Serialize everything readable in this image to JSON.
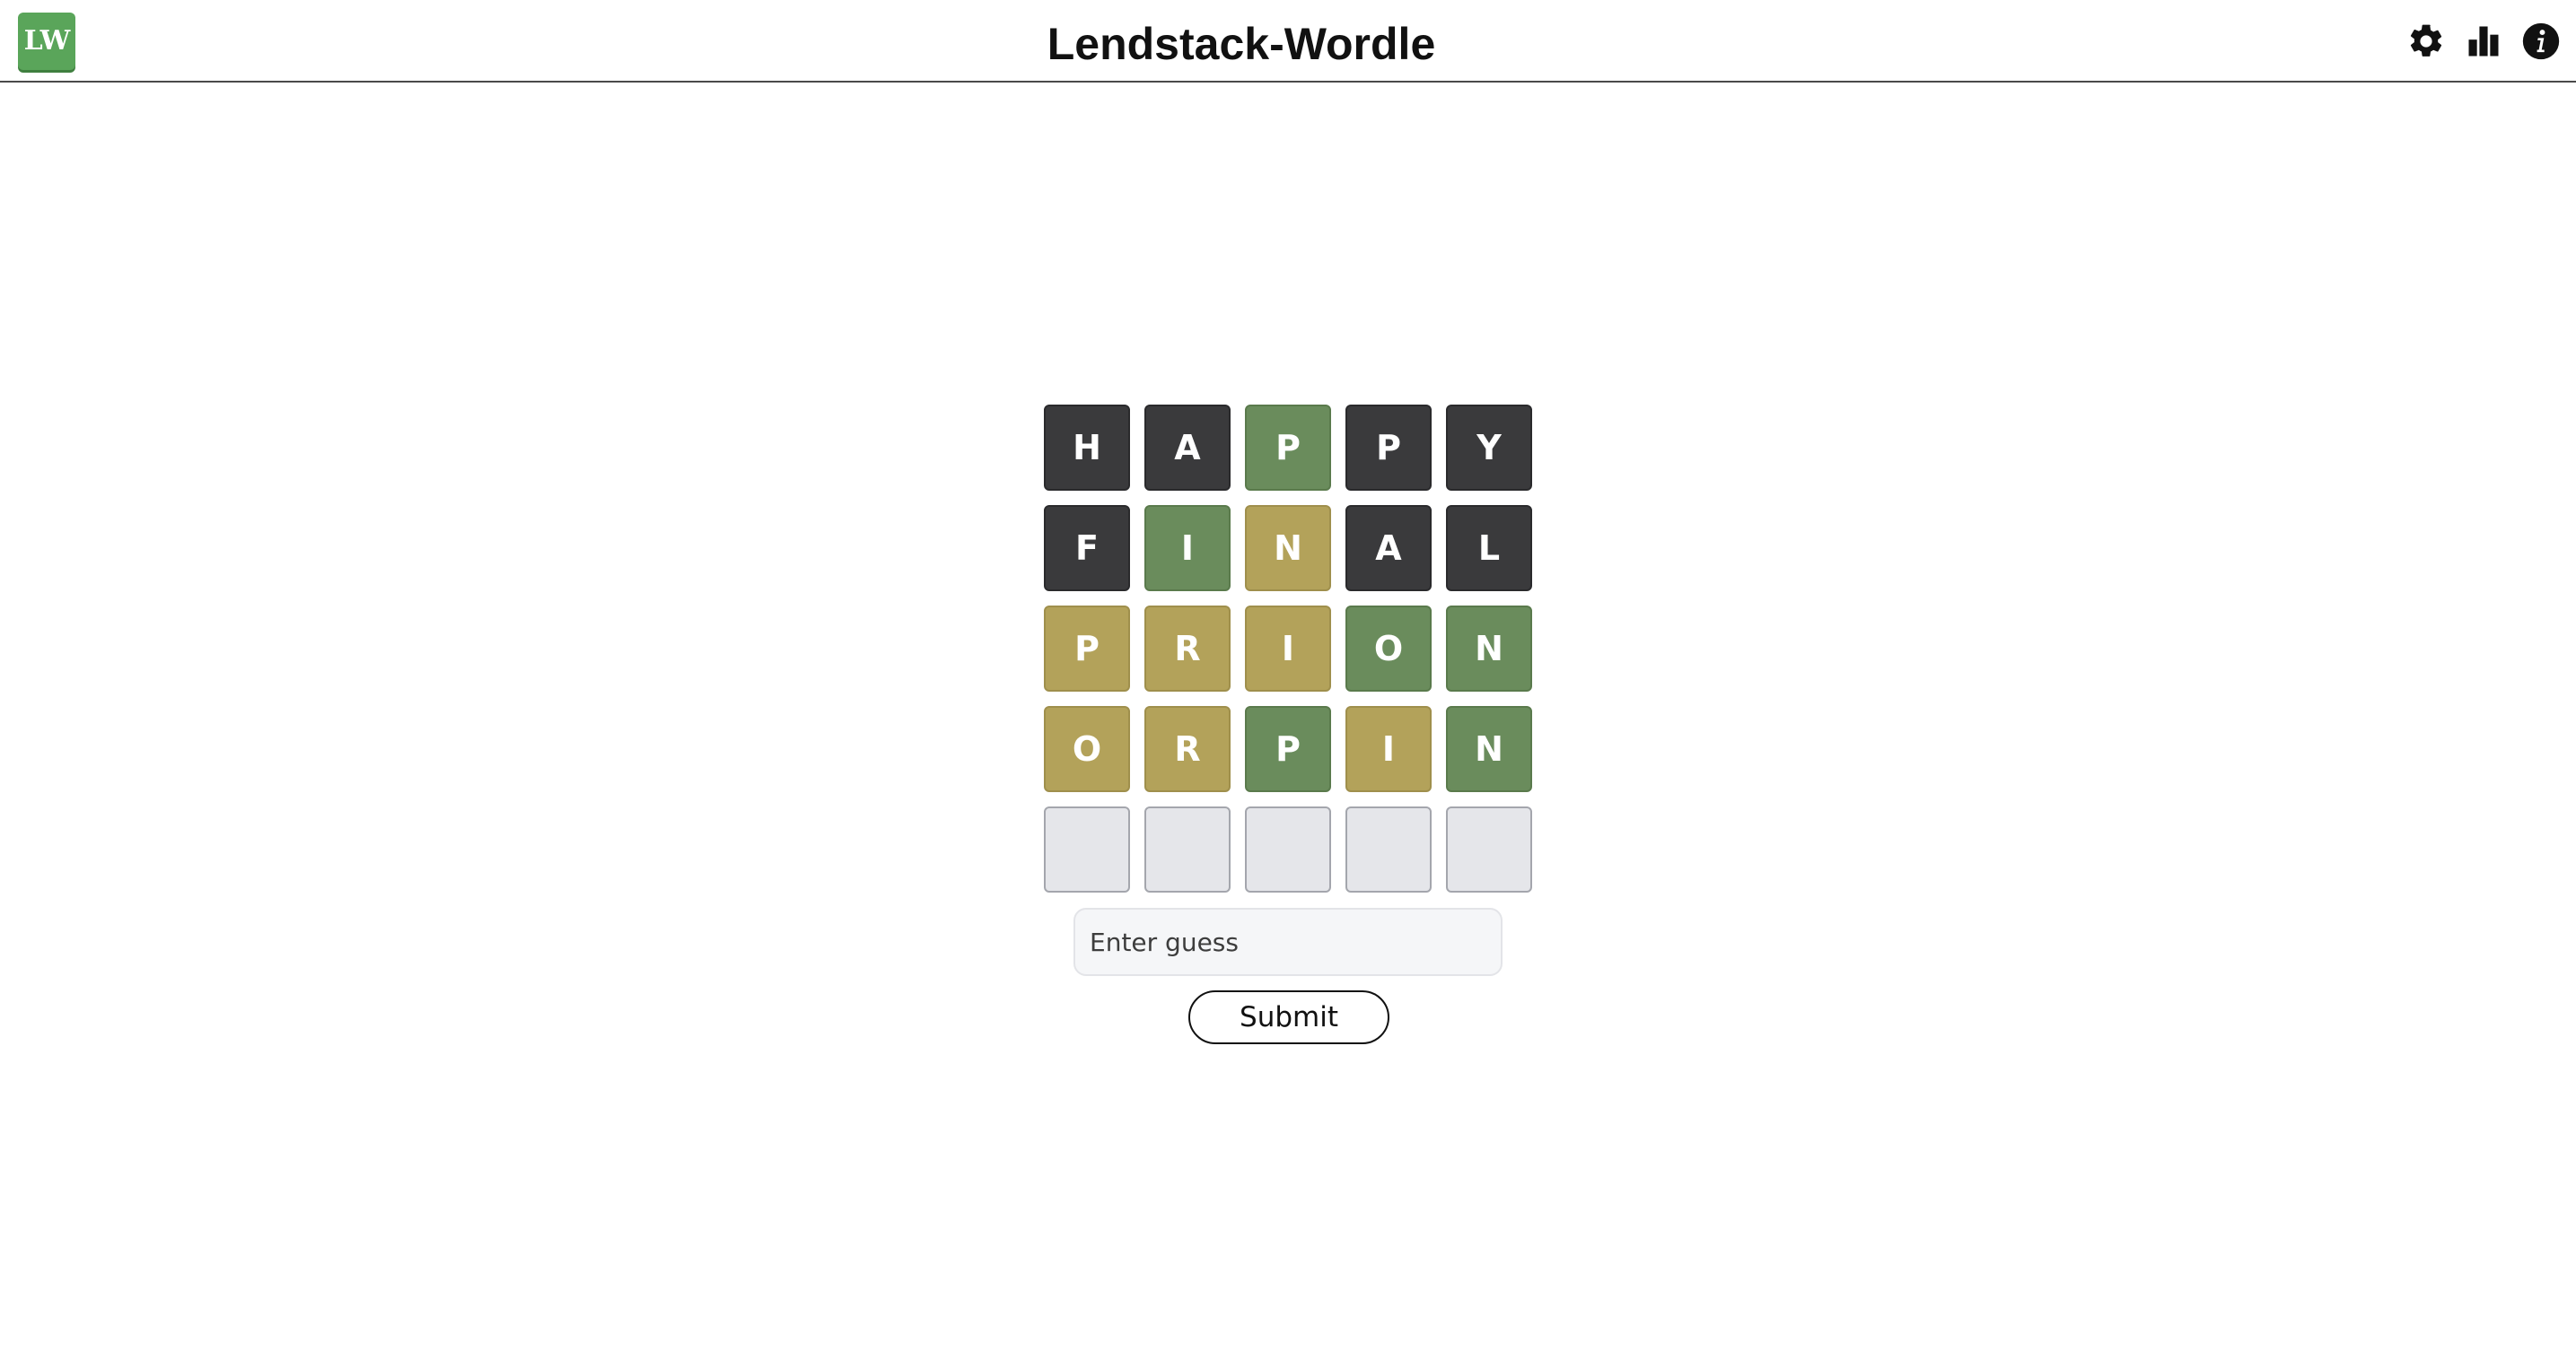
{
  "header": {
    "logo_text": "LW",
    "title": "Lendstack-Wordle",
    "icons": [
      "gear-icon",
      "bar-chart-icon",
      "info-icon"
    ]
  },
  "colors": {
    "correct": "#6a8c5c",
    "present": "#b3a25a",
    "absent": "#3a3a3c",
    "empty": "#e5e6ea",
    "logo": "#5aa55a"
  },
  "board": {
    "rows": [
      [
        {
          "letter": "H",
          "state": "absent"
        },
        {
          "letter": "A",
          "state": "absent"
        },
        {
          "letter": "P",
          "state": "correct"
        },
        {
          "letter": "P",
          "state": "absent"
        },
        {
          "letter": "Y",
          "state": "absent"
        }
      ],
      [
        {
          "letter": "F",
          "state": "absent"
        },
        {
          "letter": "I",
          "state": "correct"
        },
        {
          "letter": "N",
          "state": "present"
        },
        {
          "letter": "A",
          "state": "absent"
        },
        {
          "letter": "L",
          "state": "absent"
        }
      ],
      [
        {
          "letter": "P",
          "state": "present"
        },
        {
          "letter": "R",
          "state": "present"
        },
        {
          "letter": "I",
          "state": "present"
        },
        {
          "letter": "O",
          "state": "correct"
        },
        {
          "letter": "N",
          "state": "correct"
        }
      ],
      [
        {
          "letter": "O",
          "state": "present"
        },
        {
          "letter": "R",
          "state": "present"
        },
        {
          "letter": "P",
          "state": "correct"
        },
        {
          "letter": "I",
          "state": "present"
        },
        {
          "letter": "N",
          "state": "correct"
        }
      ],
      [
        {
          "letter": "",
          "state": "empty"
        },
        {
          "letter": "",
          "state": "empty"
        },
        {
          "letter": "",
          "state": "empty"
        },
        {
          "letter": "",
          "state": "empty"
        },
        {
          "letter": "",
          "state": "empty"
        }
      ]
    ]
  },
  "guess": {
    "value": "",
    "placeholder": "Enter guess"
  },
  "submit_label": "Submit"
}
